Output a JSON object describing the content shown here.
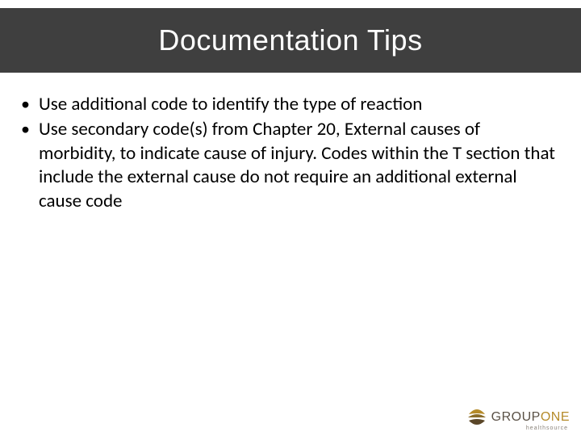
{
  "title": "Documentation Tips",
  "bullets": [
    "Use additional code to identify the type of reaction",
    "Use secondary code(s) from Chapter 20, External causes of morbidity, to indicate cause of injury. Codes within the T section that include the external cause do not require an additional external cause code"
  ],
  "logo": {
    "group": "GROUP",
    "one": "ONE",
    "sub": "healthsource"
  }
}
